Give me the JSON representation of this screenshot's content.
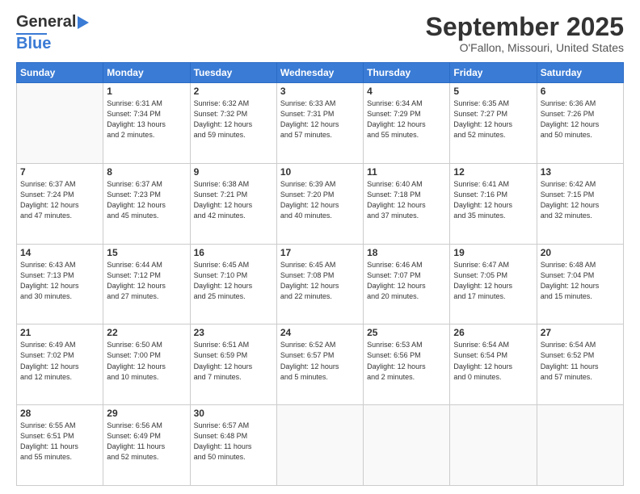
{
  "header": {
    "logo_general": "General",
    "logo_blue": "Blue",
    "month_title": "September 2025",
    "location": "O'Fallon, Missouri, United States"
  },
  "weekdays": [
    "Sunday",
    "Monday",
    "Tuesday",
    "Wednesday",
    "Thursday",
    "Friday",
    "Saturday"
  ],
  "weeks": [
    [
      {
        "day": "",
        "sunrise": "",
        "sunset": "",
        "daylight": ""
      },
      {
        "day": "1",
        "sunrise": "Sunrise: 6:31 AM",
        "sunset": "Sunset: 7:34 PM",
        "daylight": "Daylight: 13 hours and 2 minutes."
      },
      {
        "day": "2",
        "sunrise": "Sunrise: 6:32 AM",
        "sunset": "Sunset: 7:32 PM",
        "daylight": "Daylight: 12 hours and 59 minutes."
      },
      {
        "day": "3",
        "sunrise": "Sunrise: 6:33 AM",
        "sunset": "Sunset: 7:31 PM",
        "daylight": "Daylight: 12 hours and 57 minutes."
      },
      {
        "day": "4",
        "sunrise": "Sunrise: 6:34 AM",
        "sunset": "Sunset: 7:29 PM",
        "daylight": "Daylight: 12 hours and 55 minutes."
      },
      {
        "day": "5",
        "sunrise": "Sunrise: 6:35 AM",
        "sunset": "Sunset: 7:27 PM",
        "daylight": "Daylight: 12 hours and 52 minutes."
      },
      {
        "day": "6",
        "sunrise": "Sunrise: 6:36 AM",
        "sunset": "Sunset: 7:26 PM",
        "daylight": "Daylight: 12 hours and 50 minutes."
      }
    ],
    [
      {
        "day": "7",
        "sunrise": "Sunrise: 6:37 AM",
        "sunset": "Sunset: 7:24 PM",
        "daylight": "Daylight: 12 hours and 47 minutes."
      },
      {
        "day": "8",
        "sunrise": "Sunrise: 6:37 AM",
        "sunset": "Sunset: 7:23 PM",
        "daylight": "Daylight: 12 hours and 45 minutes."
      },
      {
        "day": "9",
        "sunrise": "Sunrise: 6:38 AM",
        "sunset": "Sunset: 7:21 PM",
        "daylight": "Daylight: 12 hours and 42 minutes."
      },
      {
        "day": "10",
        "sunrise": "Sunrise: 6:39 AM",
        "sunset": "Sunset: 7:20 PM",
        "daylight": "Daylight: 12 hours and 40 minutes."
      },
      {
        "day": "11",
        "sunrise": "Sunrise: 6:40 AM",
        "sunset": "Sunset: 7:18 PM",
        "daylight": "Daylight: 12 hours and 37 minutes."
      },
      {
        "day": "12",
        "sunrise": "Sunrise: 6:41 AM",
        "sunset": "Sunset: 7:16 PM",
        "daylight": "Daylight: 12 hours and 35 minutes."
      },
      {
        "day": "13",
        "sunrise": "Sunrise: 6:42 AM",
        "sunset": "Sunset: 7:15 PM",
        "daylight": "Daylight: 12 hours and 32 minutes."
      }
    ],
    [
      {
        "day": "14",
        "sunrise": "Sunrise: 6:43 AM",
        "sunset": "Sunset: 7:13 PM",
        "daylight": "Daylight: 12 hours and 30 minutes."
      },
      {
        "day": "15",
        "sunrise": "Sunrise: 6:44 AM",
        "sunset": "Sunset: 7:12 PM",
        "daylight": "Daylight: 12 hours and 27 minutes."
      },
      {
        "day": "16",
        "sunrise": "Sunrise: 6:45 AM",
        "sunset": "Sunset: 7:10 PM",
        "daylight": "Daylight: 12 hours and 25 minutes."
      },
      {
        "day": "17",
        "sunrise": "Sunrise: 6:45 AM",
        "sunset": "Sunset: 7:08 PM",
        "daylight": "Daylight: 12 hours and 22 minutes."
      },
      {
        "day": "18",
        "sunrise": "Sunrise: 6:46 AM",
        "sunset": "Sunset: 7:07 PM",
        "daylight": "Daylight: 12 hours and 20 minutes."
      },
      {
        "day": "19",
        "sunrise": "Sunrise: 6:47 AM",
        "sunset": "Sunset: 7:05 PM",
        "daylight": "Daylight: 12 hours and 17 minutes."
      },
      {
        "day": "20",
        "sunrise": "Sunrise: 6:48 AM",
        "sunset": "Sunset: 7:04 PM",
        "daylight": "Daylight: 12 hours and 15 minutes."
      }
    ],
    [
      {
        "day": "21",
        "sunrise": "Sunrise: 6:49 AM",
        "sunset": "Sunset: 7:02 PM",
        "daylight": "Daylight: 12 hours and 12 minutes."
      },
      {
        "day": "22",
        "sunrise": "Sunrise: 6:50 AM",
        "sunset": "Sunset: 7:00 PM",
        "daylight": "Daylight: 12 hours and 10 minutes."
      },
      {
        "day": "23",
        "sunrise": "Sunrise: 6:51 AM",
        "sunset": "Sunset: 6:59 PM",
        "daylight": "Daylight: 12 hours and 7 minutes."
      },
      {
        "day": "24",
        "sunrise": "Sunrise: 6:52 AM",
        "sunset": "Sunset: 6:57 PM",
        "daylight": "Daylight: 12 hours and 5 minutes."
      },
      {
        "day": "25",
        "sunrise": "Sunrise: 6:53 AM",
        "sunset": "Sunset: 6:56 PM",
        "daylight": "Daylight: 12 hours and 2 minutes."
      },
      {
        "day": "26",
        "sunrise": "Sunrise: 6:54 AM",
        "sunset": "Sunset: 6:54 PM",
        "daylight": "Daylight: 12 hours and 0 minutes."
      },
      {
        "day": "27",
        "sunrise": "Sunrise: 6:54 AM",
        "sunset": "Sunset: 6:52 PM",
        "daylight": "Daylight: 11 hours and 57 minutes."
      }
    ],
    [
      {
        "day": "28",
        "sunrise": "Sunrise: 6:55 AM",
        "sunset": "Sunset: 6:51 PM",
        "daylight": "Daylight: 11 hours and 55 minutes."
      },
      {
        "day": "29",
        "sunrise": "Sunrise: 6:56 AM",
        "sunset": "Sunset: 6:49 PM",
        "daylight": "Daylight: 11 hours and 52 minutes."
      },
      {
        "day": "30",
        "sunrise": "Sunrise: 6:57 AM",
        "sunset": "Sunset: 6:48 PM",
        "daylight": "Daylight: 11 hours and 50 minutes."
      },
      {
        "day": "",
        "sunrise": "",
        "sunset": "",
        "daylight": ""
      },
      {
        "day": "",
        "sunrise": "",
        "sunset": "",
        "daylight": ""
      },
      {
        "day": "",
        "sunrise": "",
        "sunset": "",
        "daylight": ""
      },
      {
        "day": "",
        "sunrise": "",
        "sunset": "",
        "daylight": ""
      }
    ]
  ]
}
